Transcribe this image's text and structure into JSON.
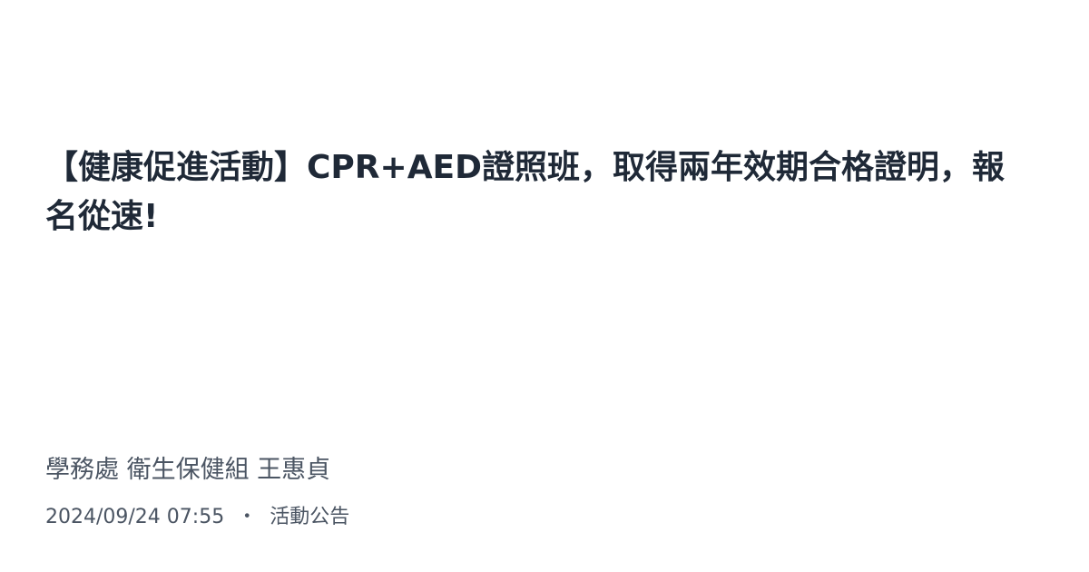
{
  "post": {
    "title": "【健康促進活動】CPR+AED證照班，取得兩年效期合格證明，報名從速!",
    "author": "學務處 衛生保健組 王惠貞",
    "datetime": "2024/09/24 07:55",
    "separator": "・",
    "category": "活動公告"
  }
}
